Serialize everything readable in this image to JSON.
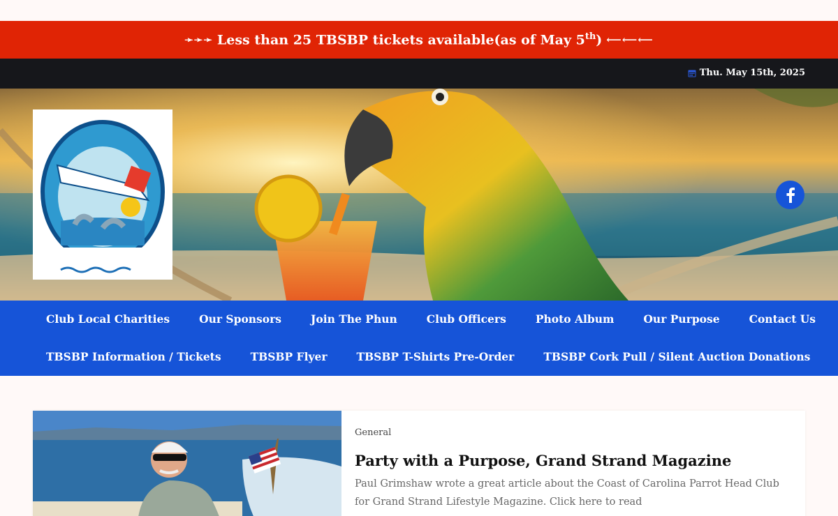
{
  "announcement": {
    "arrows_left": "➛➛➛",
    "text": "Less than 25 TBSBP tickets available(as of May 5",
    "sup": "th",
    "close": ")",
    "arrows_right": "⟵⟵⟵"
  },
  "topbar": {
    "date": "Thu. May 15th, 2025"
  },
  "nav": {
    "row1": [
      "Club Local Charities",
      "Our Sponsors",
      "Join The Phun",
      "Club Officers",
      "Photo Album",
      "Our Purpose",
      "Contact Us"
    ],
    "row2": [
      "TBSBP Information / Tickets",
      "TBSBP Flyer",
      "TBSBP T-Shirts Pre-Order",
      "TBSBP Cork Pull / Silent Auction Donations"
    ]
  },
  "post": {
    "category": "General",
    "title": "Party with a Purpose, Grand Strand Magazine",
    "excerpt": "Paul Grimshaw wrote a great article about the Coast of Carolina Parrot Head Club for Grand Strand Lifestyle Magazine. Click here to read"
  },
  "colors": {
    "announce_bg": "#e02405",
    "nav_bg": "#1654d8",
    "topbar_bg": "#16171b"
  }
}
